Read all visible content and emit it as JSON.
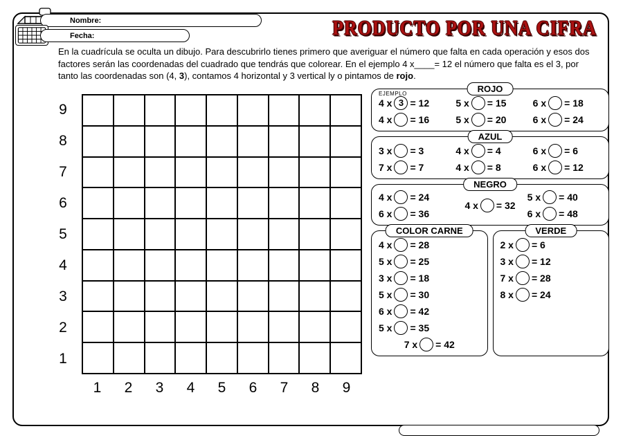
{
  "header": {
    "name_label": "Nombre:",
    "date_label": "Fecha:",
    "title": "PRODUCTO POR UNA CIFRA"
  },
  "instructions_html": "En la cuadrícula se oculta un dibujo. Para descubrirlo tienes primero que averiguar el número que falta en cada operación y esos dos factores serán las coordenadas del cuadrado que tendrás que colorear. En el ejemplo 4 x____= 12 el número que falta es el 3, por tanto las coordenadas son (4, <b>3</b>), contamos 4 horizontal y 3 vertical ly o pintamos de <b>rojo</b>.",
  "grid": {
    "x_labels": [
      "1",
      "2",
      "3",
      "4",
      "5",
      "6",
      "7",
      "8",
      "9"
    ],
    "y_labels": [
      "1",
      "2",
      "3",
      "4",
      "5",
      "6",
      "7",
      "8",
      "9"
    ]
  },
  "ejemplo_label": "EJEMPLO",
  "panels": [
    {
      "title": "ROJO",
      "problems": [
        {
          "a": "4",
          "fill": "3",
          "r": "12",
          "ej": true
        },
        {
          "a": "5",
          "r": "15"
        },
        {
          "a": "6",
          "r": "18"
        },
        {
          "a": "4",
          "r": "16"
        },
        {
          "a": "5",
          "r": "20"
        },
        {
          "a": "6",
          "r": "24"
        }
      ]
    },
    {
      "title": "AZUL",
      "problems": [
        {
          "a": "3",
          "r": "3"
        },
        {
          "a": "4",
          "r": "4"
        },
        {
          "a": "6",
          "r": "6"
        },
        {
          "a": "7",
          "r": "7"
        },
        {
          "a": "4",
          "r": "8"
        },
        {
          "a": "6",
          "r": "12"
        }
      ]
    },
    {
      "title": "NEGRO",
      "problems": [
        {
          "a": "4",
          "r": "24"
        },
        {
          "a": "4",
          "r": "32",
          "center": true
        },
        {
          "a": "5",
          "r": "40"
        },
        {
          "a": "6",
          "r": "36"
        },
        {
          "a": "6",
          "r": "48"
        }
      ],
      "layout": "negro"
    }
  ],
  "half_panels": [
    {
      "title": "COLOR CARNE",
      "problems": [
        {
          "a": "4",
          "r": "28"
        },
        {
          "a": "5",
          "r": "25"
        },
        {
          "a": "3",
          "r": "18"
        },
        {
          "a": "5",
          "r": "30"
        },
        {
          "a": "6",
          "r": "42"
        },
        {
          "a": "5",
          "r": "35"
        },
        {
          "a": "7",
          "r": "42",
          "full": true
        }
      ]
    },
    {
      "title": "VERDE",
      "problems": [
        {
          "a": "2",
          "r": "6"
        },
        {
          "a": "3",
          "r": "12"
        },
        {
          "a": "7",
          "r": "28"
        },
        {
          "a": "8",
          "r": "24"
        }
      ]
    }
  ]
}
